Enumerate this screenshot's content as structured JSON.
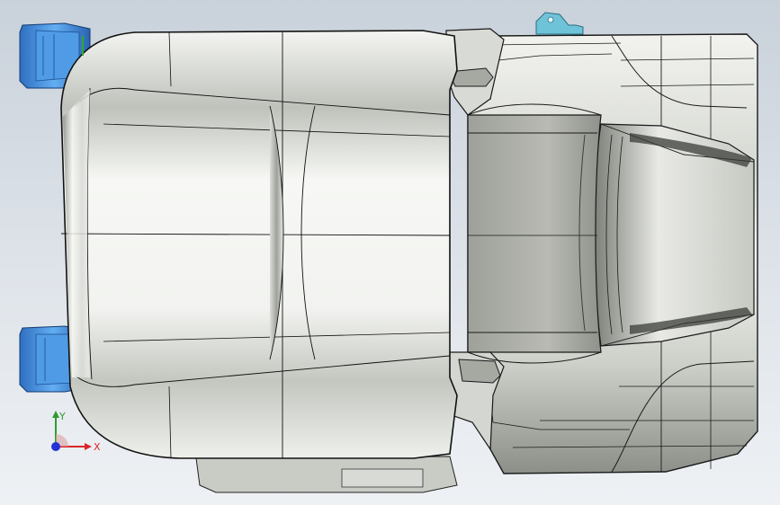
{
  "viewport": {
    "background_top": "#c9d1da",
    "background_bottom": "#eef1f4"
  },
  "model": {
    "body_color": "#e8e9e6",
    "shade_color": "#b9bcb5",
    "edge_color": "#1a1a1a",
    "accent_color": "#3d8fe0"
  },
  "triad": {
    "x_label": "X",
    "y_label": "Y",
    "x_color": "#d9262a",
    "y_color": "#2f9b2f",
    "z_color": "#2432d6"
  }
}
